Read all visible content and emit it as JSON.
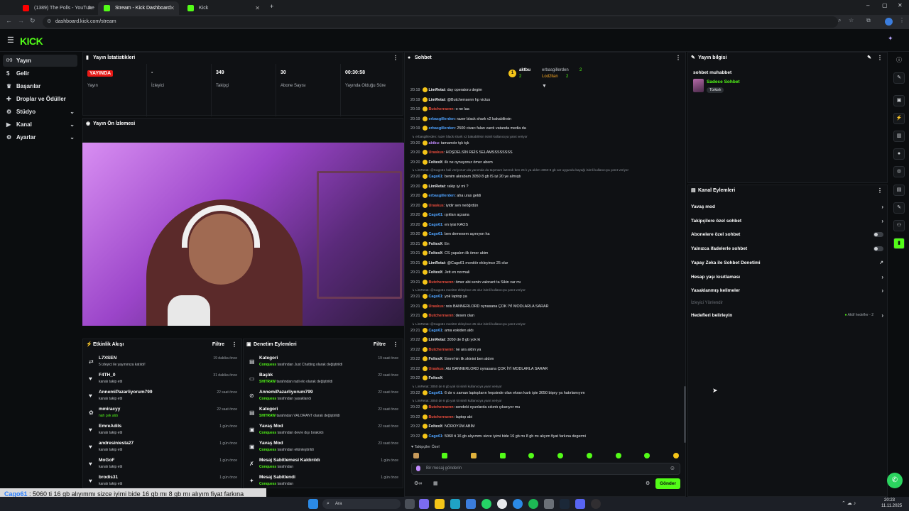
{
  "browser": {
    "tabs": [
      {
        "title": "(1389) The Polls - YouTube",
        "active": false,
        "color": "#ff0000"
      },
      {
        "title": "Stream - Kick Dashboard",
        "active": true,
        "color": "#53fc18"
      },
      {
        "title": "Kick",
        "active": false,
        "color": "#53fc18"
      }
    ],
    "url": "dashboard.kick.com/stream"
  },
  "app": {
    "logo": "KICK",
    "accent": "#53fc18"
  },
  "sidebar": {
    "items": [
      {
        "label": "Yayın",
        "icon": "broadcast-icon",
        "expandable": false,
        "selected": true
      },
      {
        "label": "Gelir",
        "icon": "money-icon",
        "expandable": false
      },
      {
        "label": "Başarılar",
        "icon": "trophy-icon",
        "expandable": false
      },
      {
        "label": "Droplar ve Ödüller",
        "icon": "gift-icon",
        "expandable": false
      },
      {
        "label": "Stüdyo",
        "icon": "studio-icon",
        "expandable": true
      },
      {
        "label": "Kanal",
        "icon": "channel-icon",
        "expandable": true
      },
      {
        "label": "Ayarlar",
        "icon": "gear-icon",
        "expandable": true
      }
    ]
  },
  "stats": {
    "title": "Yayın İstatistikleri",
    "items": [
      {
        "value": "YAYINDA",
        "label": "Yayın"
      },
      {
        "value": "-",
        "label": "İzleyici"
      },
      {
        "value": "349",
        "label": "Takipçi"
      },
      {
        "value": "30",
        "label": "Abone Sayısı"
      },
      {
        "value": "00:30:58",
        "label": "Yayında Olduğu Süre"
      }
    ]
  },
  "preview": {
    "title": "Yayın Ön İzlemesi"
  },
  "activity": {
    "title": "Etkinlik Akışı",
    "filter": "Filtre",
    "rows": [
      {
        "icon": "raid-icon",
        "name": "L7XSEN",
        "desc": "5 izleyici ile yayınınıza katıldı!",
        "time": "19 dakika önce"
      },
      {
        "icon": "heart-icon",
        "name": "F4TH_0",
        "desc": "kanalı takip etti",
        "time": "31 dakika önce"
      },
      {
        "icon": "heart-icon",
        "name": "AnnemiPazarliyorum799",
        "desc": "kanalı takip etti",
        "time": "22 saat önce"
      },
      {
        "icon": "gift-icon",
        "name": "mmiracyy",
        "desc": "nah çek aldı",
        "time": "22 saat önce"
      },
      {
        "icon": "heart-icon",
        "name": "EmreAdils",
        "desc": "kanalı takip etti",
        "time": "1 gün önce"
      },
      {
        "icon": "heart-icon",
        "name": "andresiniesta27",
        "desc": "kanalı takip etti",
        "time": "1 gün önce"
      },
      {
        "icon": "heart-icon",
        "name": "MoGoF",
        "desc": "kanalı takip etti",
        "time": "1 gün önce"
      },
      {
        "icon": "heart-icon",
        "name": "brodis31",
        "desc": "kanalı takip etti",
        "time": "1 gün önce"
      }
    ]
  },
  "moderation": {
    "title": "Denetim Eylemleri",
    "filter": "Filtre",
    "rows": [
      {
        "icon": "category-icon",
        "name": "Kategori",
        "user": "Conquess",
        "desc": "tarafından Just Chatting olarak değiştirildi",
        "time": "19 saat önce"
      },
      {
        "icon": "title-icon",
        "name": "Başlık",
        "user": "SHITRAW",
        "desc": "tarafından radi elo olarak değiştirildi",
        "time": "22 saat önce"
      },
      {
        "icon": "ban-icon",
        "name": "AnnemiPazarliyorum799",
        "user": "Conquess",
        "desc": "tarafından yasaklandı",
        "time": "22 saat önce"
      },
      {
        "icon": "category-icon",
        "name": "Kategori",
        "user": "SHITRAW",
        "desc": "tarafından VALORANT olarak değiştirildi",
        "time": "22 saat önce"
      },
      {
        "icon": "slow-icon",
        "name": "Yavaş Mod",
        "user": "Conquess",
        "desc": "tarafından devre dışı bırakıldı",
        "time": "22 saat önce"
      },
      {
        "icon": "slow-icon",
        "name": "Yavaş Mod",
        "user": "Conquess",
        "desc": "tarafından etkinleştirildi",
        "time": "23 saat önce"
      },
      {
        "icon": "unpin-icon",
        "name": "Mesaj Sabitlemesi Kaldırıldı",
        "user": "Conquess",
        "desc": "tarafından",
        "time": "1 gün önce"
      },
      {
        "icon": "pin-icon",
        "name": "Mesaj Sabitlendi",
        "user": "Conquess",
        "desc": "tarafından",
        "time": "1 gün önce"
      }
    ]
  },
  "chat": {
    "title": "Sohbet",
    "leaderboard": [
      {
        "rank": "1",
        "name": "aktbu",
        "count": "2"
      },
      {
        "rank": "",
        "name": "erbasgillerden",
        "count": "2"
      },
      {
        "rank": "",
        "name": "Lod2llan",
        "count": "2"
      }
    ],
    "messages": [
      {
        "time": "20:19",
        "user": "LimRetat",
        "color": "#e8eaed",
        "text": "day operatoru degim"
      },
      {
        "time": "20:19",
        "user": "LimRetat",
        "color": "#e8eaed",
        "text": "@Butcherraenn hp victus"
      },
      {
        "time": "20:19",
        "user": "Butcherraenn",
        "color": "#e74c3c",
        "text": "o ne laa"
      },
      {
        "time": "20:19",
        "user": "erbasgillerden",
        "color": "#4fa3ff",
        "text": "razer black shark v2 bakabilirsin"
      },
      {
        "time": "20:19",
        "user": "erbasgillerden",
        "color": "#4fa3ff",
        "text": "2500 civarı falan vardı vatanda media da"
      },
      {
        "reply": "erbasgillerden: razer black shark v2 bakabilirsin isimli kullanıcıya yanıt veriyor"
      },
      {
        "time": "20:20",
        "user": "aktbu",
        "color": "#c18bff",
        "text": "tamamdır tşk tşk"
      },
      {
        "time": "20:20",
        "user": "Uraskus",
        "color": "#e74c3c",
        "text": "HOŞDELSİN REİS SELAMSSSSSSSS"
      },
      {
        "time": "20:20",
        "user": "FoltexX",
        "color": "#e8eaed",
        "text": "ilk ne oynuyoruz ömer abem"
      },
      {
        "reply": "LimRetat: @Cago61 hali veriyorum da yanımda da taşımam lazımdı ben 25 k ya aldım 3050 8 gb var uygundu bayağı isimli kullanıcıya yanıt veriyor"
      },
      {
        "time": "20:20",
        "user": "Cago61",
        "color": "#4fa3ff",
        "text": "benim akrabam 3050 8 gb lS iyi 20 ye almıştı"
      },
      {
        "time": "20:20",
        "user": "LimRetat",
        "color": "#e8eaed",
        "text": "rakip iyi mi ?"
      },
      {
        "time": "20:20",
        "user": "erbasgillerden",
        "color": "#4fa3ff",
        "text": "aha uras geldi"
      },
      {
        "time": "20:20",
        "user": "Uraskus",
        "color": "#e74c3c",
        "text": "iyidir sen neöğrdün"
      },
      {
        "time": "20:20",
        "user": "Cago61",
        "color": "#4fa3ff",
        "text": "ışıkları açsana"
      },
      {
        "time": "20:20",
        "user": "Cago61",
        "color": "#4fa3ff",
        "text": "en iyisi KAOS"
      },
      {
        "time": "20:20",
        "user": "Cago61",
        "color": "#4fa3ff",
        "text": "ben demesem açmıyon ha"
      },
      {
        "time": "20:21",
        "user": "FoltexX",
        "color": "#e8eaed",
        "text": "En"
      },
      {
        "time": "20:21",
        "user": "FoltexX",
        "color": "#e8eaed",
        "text": "CS yapalım ilk ömer abim"
      },
      {
        "time": "20:21",
        "user": "LimRetat",
        "color": "#e8eaed",
        "text": "@Cago61 monitör ekleyince 25 olur"
      },
      {
        "time": "20:21",
        "user": "FoltexX",
        "color": "#e8eaed",
        "text": "Jett en normali"
      },
      {
        "time": "20:21",
        "user": "Butcherraenn",
        "color": "#e74c3c",
        "text": "ömer abi senin valorant ta Sikin var mı"
      },
      {
        "reply": "LimRetat: @Cago61 monitör ekleyince 25 olur isimli kullanıcıya yanıt veriyor"
      },
      {
        "time": "20:21",
        "user": "Cago61",
        "color": "#4fa3ff",
        "text": "yok laptop ya"
      },
      {
        "time": "20:21",
        "user": "Uraskus",
        "color": "#e74c3c",
        "text": "reis BANNERLORD oynasana ÇOK İYİ MODLARLA SARAR"
      },
      {
        "time": "20:21",
        "user": "Butcherraenn",
        "color": "#e74c3c",
        "text": "desen olan"
      },
      {
        "reply": "LimRetat: @Cago61 monitör ekleyince 25 olur isimli kullanıcıya yanıt veriyor"
      },
      {
        "time": "20:21",
        "user": "Cago61",
        "color": "#4fa3ff",
        "text": "ama eskiden aldı"
      },
      {
        "time": "20:22",
        "user": "LimRetat",
        "color": "#e8eaed",
        "text": "3050 de 8 gb yok ki"
      },
      {
        "time": "20:22",
        "user": "Butcherraenn",
        "color": "#e74c3c",
        "text": "ne ara aldın ya"
      },
      {
        "time": "20:22",
        "user": "FoltexX",
        "color": "#e8eaed",
        "text": "Emre'nin lik skinini ben aldım"
      },
      {
        "time": "20:22",
        "user": "Uraskus",
        "color": "#e74c3c",
        "text": "Abi BANNERLORD oynasana ÇOK İYİ MODLARLA SARAR"
      },
      {
        "time": "20:22",
        "user": "FoltexX",
        "color": "#e8eaed",
        "text": ""
      },
      {
        "reply": "LimRetat: 3050 de 8 gb yok ki isimli kullanıcıya yanıt veriyor"
      },
      {
        "time": "20:22",
        "user": "Cago61",
        "color": "#4fa3ff",
        "text": "6 dır o zaman laptopların hepsinde olan ekran kartı işte 3050 bişey ya hatırlamıyım"
      },
      {
        "reply": "LimRetat: 3050 de 8 gb yok ki isimli kullanıcıya yanıt veriyor"
      },
      {
        "time": "20:22",
        "user": "Butcherraenn",
        "color": "#e74c3c",
        "text": "sendeki oyunlarda sıkıntı çıkarıyor mu"
      },
      {
        "time": "20:22",
        "user": "Butcherraenn",
        "color": "#e74c3c",
        "text": "laptop abi"
      },
      {
        "time": "20:22",
        "user": "FoltexX",
        "color": "#e8eaed",
        "text": "NÖROYÜM ABİM"
      },
      {
        "time": "20:22",
        "user": "Cago61",
        "color": "#4fa3ff",
        "text": "5060 ti 16 gb alıyımmı sizce iyimi bide 16 gb mı 8 gb mı alıyım fiyat farkına degermi"
      }
    ],
    "follower_mode": "Takipçiler Özel",
    "input_placeholder": "Bir mesaj gönderin",
    "send_label": "Gönder"
  },
  "stream_info": {
    "title": "Yayın bilgisi",
    "stream_title": "sohbet muhabbet",
    "category": "Sadece Sohbet",
    "tag": "Türkish"
  },
  "channel_actions": {
    "title": "Kanal Eylemleri",
    "items": [
      {
        "label": "Yavaş mod",
        "control": "arrow"
      },
      {
        "label": "Takipçilere özel sohbet",
        "control": "arrow"
      },
      {
        "label": "Abonelere özel sohbet",
        "control": "toggle"
      },
      {
        "label": "Yalnızca ifadelerle sohbet",
        "control": "toggle"
      },
      {
        "label": "Yapay Zeka ile Sohbet Denetimi",
        "control": "external"
      },
      {
        "label": "Hesap yaşı kısıtlaması",
        "control": "arrow"
      },
      {
        "label": "Yasaklanmış kelimeler",
        "control": "arrow"
      }
    ],
    "viewer_direction": "İzleyici Yönlendir",
    "goals_label": "Hedefleri belirleyin",
    "goals_status": "Aktif hedefler - 2"
  },
  "overlay": {
    "user": "Cago61",
    "text": "5060 ti 16 gb alıyımmı sizce iyimi bide 16 gb mı 8 gb mı alıyım fiyat farkına degermi"
  },
  "taskbar": {
    "search": "Ara",
    "time": "20:23",
    "date": "11.11.2025"
  }
}
